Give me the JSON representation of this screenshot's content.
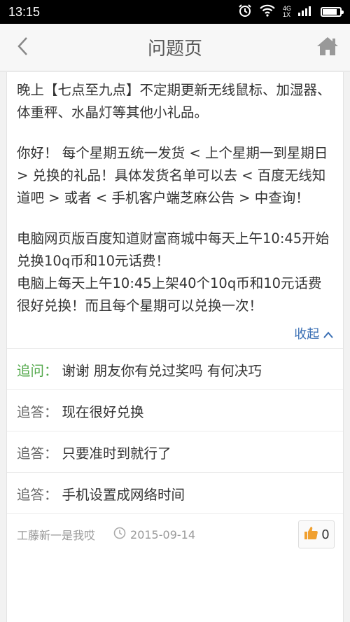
{
  "status_bar": {
    "time": "13:15",
    "network_top": "4G",
    "network_bottom": "1X",
    "battery_level": 0.85
  },
  "nav": {
    "title": "问题页"
  },
  "answer": {
    "paragraphs": [
      "晚上【七点至九点】不定期更新无线鼠标、加湿器、体重秤、水晶灯等其他小礼品。",
      "你好！ 每个星期五统一发货 < 上个星期一到星期日 > 兑换的礼品！具体发货名单可以去 < 百度无线知道吧 > 或者 < 手机客户端芝麻公告 > 中查询！",
      "电脑网页版百度知道财富商城中每天上午10:45开始兑换10q币和10元话费！\n电脑上每天上午10:45上架40个10q币和10元话费很好兑换！而且每个星期可以兑换一次！"
    ],
    "collapse_label": "收起"
  },
  "followups": [
    {
      "label": "追问：",
      "text": "谢谢 朋友你有兑过奖吗 有何决巧",
      "highlight": true
    },
    {
      "label": "追答：",
      "text": "现在很好兑换",
      "highlight": false
    },
    {
      "label": "追答：",
      "text": "只要准时到就行了",
      "highlight": false
    },
    {
      "label": "追答：",
      "text": "手机设置成网络时间",
      "highlight": false
    }
  ],
  "footer": {
    "author": "工藤新一是我哎",
    "date": "2015-09-14",
    "likes": "0"
  },
  "colors": {
    "accent_link": "#3a6fb4",
    "followup_green": "#52a84a",
    "like_orange": "#f0a030"
  },
  "icons": {
    "back": "chevron-left-icon",
    "home": "home-icon",
    "collapse": "chevron-up-icon",
    "clock": "clock-icon",
    "like": "thumbs-up-icon",
    "alarm": "alarm-icon",
    "wifi": "wifi-icon",
    "signal": "signal-icon",
    "battery": "battery-icon"
  }
}
